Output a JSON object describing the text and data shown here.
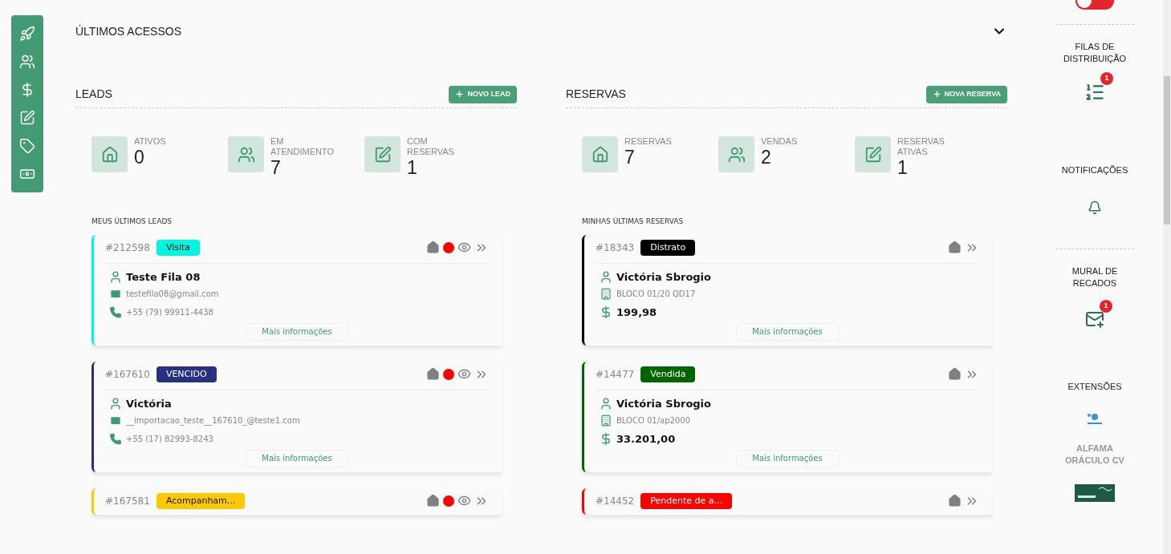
{
  "sidebar": {
    "items": [
      {
        "kind": "rocket"
      },
      {
        "kind": "users"
      },
      {
        "kind": "dollar"
      },
      {
        "kind": "edit"
      },
      {
        "kind": "tag"
      },
      {
        "kind": "atm"
      }
    ]
  },
  "recent_access": {
    "title": "ÚLTIMOS ACESSOS",
    "expanded": false
  },
  "leads": {
    "title": "LEADS",
    "button": "NOVO LEAD",
    "stats": [
      {
        "kind": "home",
        "label": "ATIVOS",
        "value": "0"
      },
      {
        "kind": "people",
        "label": "EM ATENDIMENTO",
        "value": "7"
      },
      {
        "kind": "doc",
        "label": "COM RESERVAS",
        "value": "1"
      }
    ],
    "list_title": "MEUS ÚLTIMOS LEADS",
    "cards": [
      {
        "id": "#212598",
        "tag": "Visita",
        "color": "#00f5e0",
        "name": "Teste Fila 08",
        "email": "testefila08@gmail.com",
        "phone": "+55 (79) 99911-4438",
        "more": "Mais informações"
      },
      {
        "id": "#167610",
        "tag": "VENCIDO",
        "color": "#283080",
        "name": "Victória",
        "email": "__importacao_teste__167610_@teste1.com",
        "phone": "+55 (17) 82993-8243",
        "more": "Mais informações"
      },
      {
        "id": "#167581",
        "tag": "Acompanham...",
        "color": "#ffc800"
      }
    ]
  },
  "reservas": {
    "title": "RESERVAS",
    "button": "NOVA RESERVA",
    "stats": [
      {
        "kind": "home",
        "label": "RESERVAS",
        "value": "7"
      },
      {
        "kind": "people",
        "label": "VENDAS",
        "value": "2"
      },
      {
        "kind": "doc",
        "label": "RESERVAS ATIVAS",
        "value": "1"
      }
    ],
    "list_title": "MINHAS ÚLTIMAS RESERVAS",
    "cards": [
      {
        "id": "#18343",
        "tag": "Distrato",
        "color": "#000000",
        "name": "Victória Sbrogio",
        "unit": "BLOCO 01/20 QD17",
        "price": "199,98",
        "more": "Mais informações"
      },
      {
        "id": "#14477",
        "tag": "Vendida",
        "color": "#006400",
        "name": "Victória Sbrogio",
        "unit": "BLOCO 01/ap2000",
        "price": "33.201,00",
        "more": "Mais informações"
      },
      {
        "id": "#14452",
        "tag": "Pendente de a...",
        "color": "#ff0000"
      }
    ]
  },
  "right_panel": {
    "toggle": {
      "on": false
    },
    "sections": [
      {
        "kind": "queues",
        "title": "FILAS DE DISTRIBUIÇÃO",
        "badge": "1"
      },
      {
        "kind": "notifications",
        "title": "NOTIFICAÇÕES"
      },
      {
        "kind": "board",
        "title": "MURAL DE RECADOS",
        "badge": "1"
      },
      {
        "kind": "extensions",
        "title": "EXTENSÕES",
        "extensions": [
          "ALFAMA ORÁCULO CV"
        ]
      }
    ]
  }
}
